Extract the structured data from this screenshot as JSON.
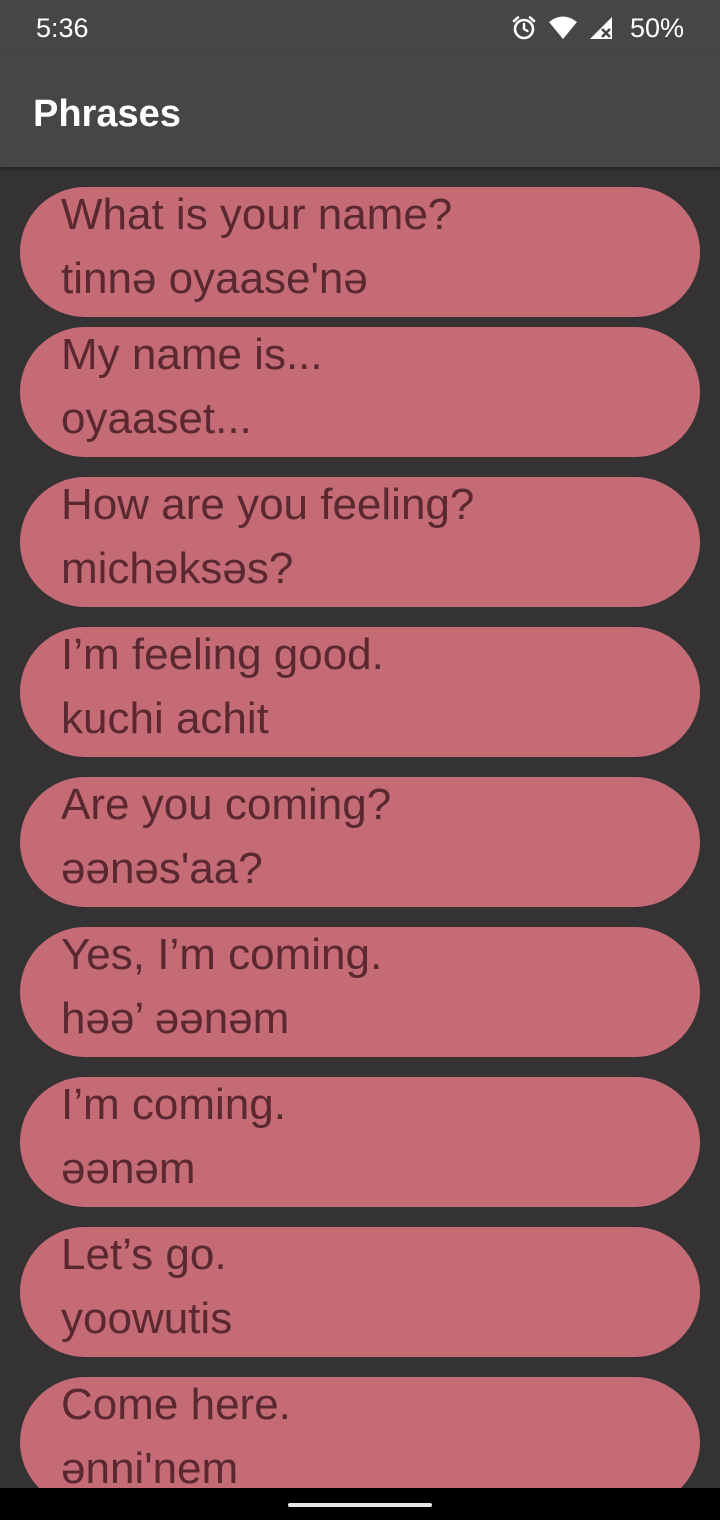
{
  "status_bar": {
    "time": "5:36",
    "battery_percent": "50%",
    "icons": [
      "alarm-icon",
      "wifi-icon",
      "cell-signal-icon",
      "battery-icon"
    ]
  },
  "app_bar": {
    "title": "Phrases"
  },
  "colors": {
    "background": "#353233",
    "app_bar": "#474647",
    "card": "#c56b75",
    "card_text": "#5a2830"
  },
  "phrases": [
    {
      "english": "What is your name?",
      "native": "tinnə oyaase'nə"
    },
    {
      "english": "My name is...",
      "native": "oyaaset..."
    },
    {
      "english": "How are you feeling?",
      "native": "michəksəs?"
    },
    {
      "english": "I’m feeling good.",
      "native": "kuchi achit"
    },
    {
      "english": "Are you coming?",
      "native": "əənəs'aa?"
    },
    {
      "english": "Yes, I’m coming.",
      "native": "həə’ əənəm"
    },
    {
      "english": "I’m coming.",
      "native": "əənəm"
    },
    {
      "english": "Let’s go.",
      "native": "yoowutis"
    },
    {
      "english": "Come here.",
      "native": "ənni'nem"
    }
  ]
}
